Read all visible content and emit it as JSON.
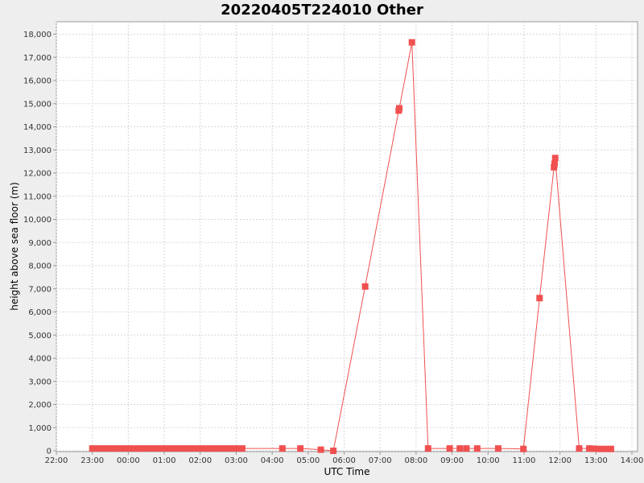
{
  "chart_data": {
    "type": "line",
    "title": "20220405T224010 Other",
    "xlabel": "UTC Time",
    "ylabel": "height above sea floor (m)",
    "xlim": [
      "2022-04-05T22:00",
      "2022-04-06T14:00"
    ],
    "ylim": [
      0,
      18500
    ],
    "grid": true,
    "x_ticks": [
      "22:00",
      "23:00",
      "00:00",
      "01:00",
      "02:00",
      "03:00",
      "04:00",
      "05:00",
      "06:00",
      "07:00",
      "08:00",
      "09:00",
      "10:00",
      "11:00",
      "12:00",
      "13:00",
      "14:00"
    ],
    "y_ticks": [
      "0",
      "1,000",
      "2,000",
      "3,000",
      "4,000",
      "5,000",
      "6,000",
      "7,000",
      "8,000",
      "9,000",
      "10,000",
      "11,000",
      "12,000",
      "13,000",
      "14,000",
      "15,000",
      "16,000",
      "17,000",
      "18,000"
    ],
    "series": [
      {
        "color": "#f05050",
        "marker": "square",
        "x": [
          "2022-04-05T23:00",
          "2022-04-05T23:10",
          "2022-04-05T23:20",
          "2022-04-05T23:30",
          "2022-04-05T23:40",
          "2022-04-05T23:50",
          "2022-04-06T00:00",
          "2022-04-06T00:10",
          "2022-04-06T00:20",
          "2022-04-06T00:30",
          "2022-04-06T00:40",
          "2022-04-06T00:50",
          "2022-04-06T01:00",
          "2022-04-06T01:10",
          "2022-04-06T01:20",
          "2022-04-06T01:30",
          "2022-04-06T01:40",
          "2022-04-06T01:50",
          "2022-04-06T02:00",
          "2022-04-06T02:10",
          "2022-04-06T02:20",
          "2022-04-06T02:30",
          "2022-04-06T02:40",
          "2022-04-06T02:50",
          "2022-04-06T03:00",
          "2022-04-06T03:10",
          "2022-04-06T04:17",
          "2022-04-06T04:47",
          "2022-04-06T05:21",
          "2022-04-06T05:42",
          "2022-04-06T06:35",
          "2022-04-06T07:31",
          "2022-04-06T07:32",
          "2022-04-06T07:53",
          "2022-04-06T08:20",
          "2022-04-06T08:56",
          "2022-04-06T09:13",
          "2022-04-06T09:24",
          "2022-04-06T09:42",
          "2022-04-06T10:17",
          "2022-04-06T10:59",
          "2022-04-06T11:26",
          "2022-04-06T11:50",
          "2022-04-06T11:51",
          "2022-04-06T11:52",
          "2022-04-06T12:32",
          "2022-04-06T12:49",
          "2022-04-06T12:55",
          "2022-04-06T13:05",
          "2022-04-06T13:15",
          "2022-04-06T13:25"
        ],
        "values": [
          100,
          100,
          100,
          100,
          100,
          100,
          100,
          100,
          100,
          100,
          100,
          100,
          100,
          100,
          100,
          100,
          100,
          100,
          100,
          100,
          100,
          100,
          100,
          100,
          100,
          100,
          100,
          100,
          50,
          0,
          7100,
          14700,
          14800,
          17650,
          100,
          100,
          100,
          100,
          100,
          100,
          80,
          6600,
          12250,
          12400,
          12650,
          100,
          100,
          90,
          80,
          80,
          80
        ]
      }
    ]
  }
}
